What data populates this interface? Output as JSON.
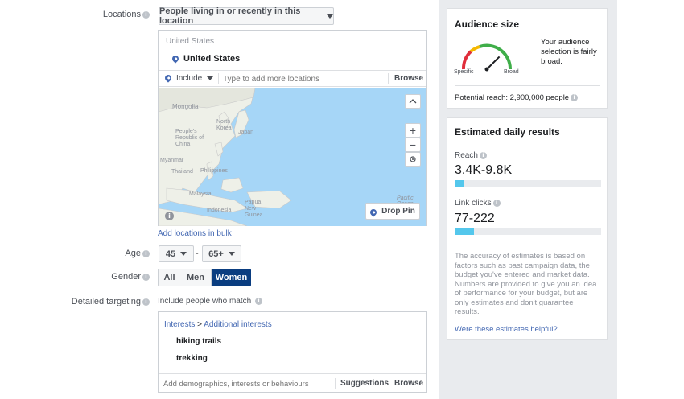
{
  "locations": {
    "label": "Locations",
    "mode_value": "People living in or recently in this location",
    "country_header": "United States",
    "selected_location": "United States",
    "include_label": "Include",
    "search_placeholder": "Type to add more locations",
    "browse_label": "Browse",
    "map_labels": [
      "Mongolia",
      "North Korea",
      "Japan",
      "People's Republic of China",
      "Myanmar",
      "Thailand",
      "Philippines",
      "Malaysia",
      "Indonesia",
      "Papua New Guinea",
      "Pacific Ocean"
    ],
    "drop_pin_label": "Drop Pin",
    "bulk_link": "Add locations in bulk"
  },
  "age": {
    "label": "Age",
    "min": "45",
    "separator": "-",
    "max": "65+"
  },
  "gender": {
    "label": "Gender",
    "options": [
      "All",
      "Men",
      "Women"
    ],
    "selected": "Women"
  },
  "detailed_targeting": {
    "label": "Detailed targeting",
    "include_text": "Include people who match",
    "breadcrumb_root": "Interests",
    "breadcrumb_sep": ">",
    "breadcrumb_child": "Additional interests",
    "items": [
      "hiking trails",
      "trekking"
    ],
    "placeholder": "Add demographics, interests or behaviours",
    "suggestions_label": "Suggestions",
    "browse_label": "Browse"
  },
  "audience_size": {
    "title": "Audience size",
    "description": "Your audience selection is fairly broad.",
    "gauge_specific": "Specific",
    "gauge_broad": "Broad",
    "gauge_level": 0.75,
    "potential_reach": "Potential reach: 2,900,000 people"
  },
  "daily_results": {
    "title": "Estimated daily results",
    "reach_label": "Reach",
    "reach_value": "3.4K-9.8K",
    "reach_fill": 0.06,
    "clicks_label": "Link clicks",
    "clicks_value": "77-222",
    "clicks_fill": 0.13,
    "disclaimer": "The accuracy of estimates is based on factors such as past campaign data, the budget you've entered and market data. Numbers are provided to give you an idea of performance for your budget, but are only estimates and don't guarantee results.",
    "feedback_link": "Were these estimates helpful?"
  },
  "colors": {
    "accent": "#4267b2",
    "selected_gender": "#0a3d80",
    "bar": "#54c7ec",
    "water": "#a6d6f7",
    "land": "#eef0e8"
  }
}
